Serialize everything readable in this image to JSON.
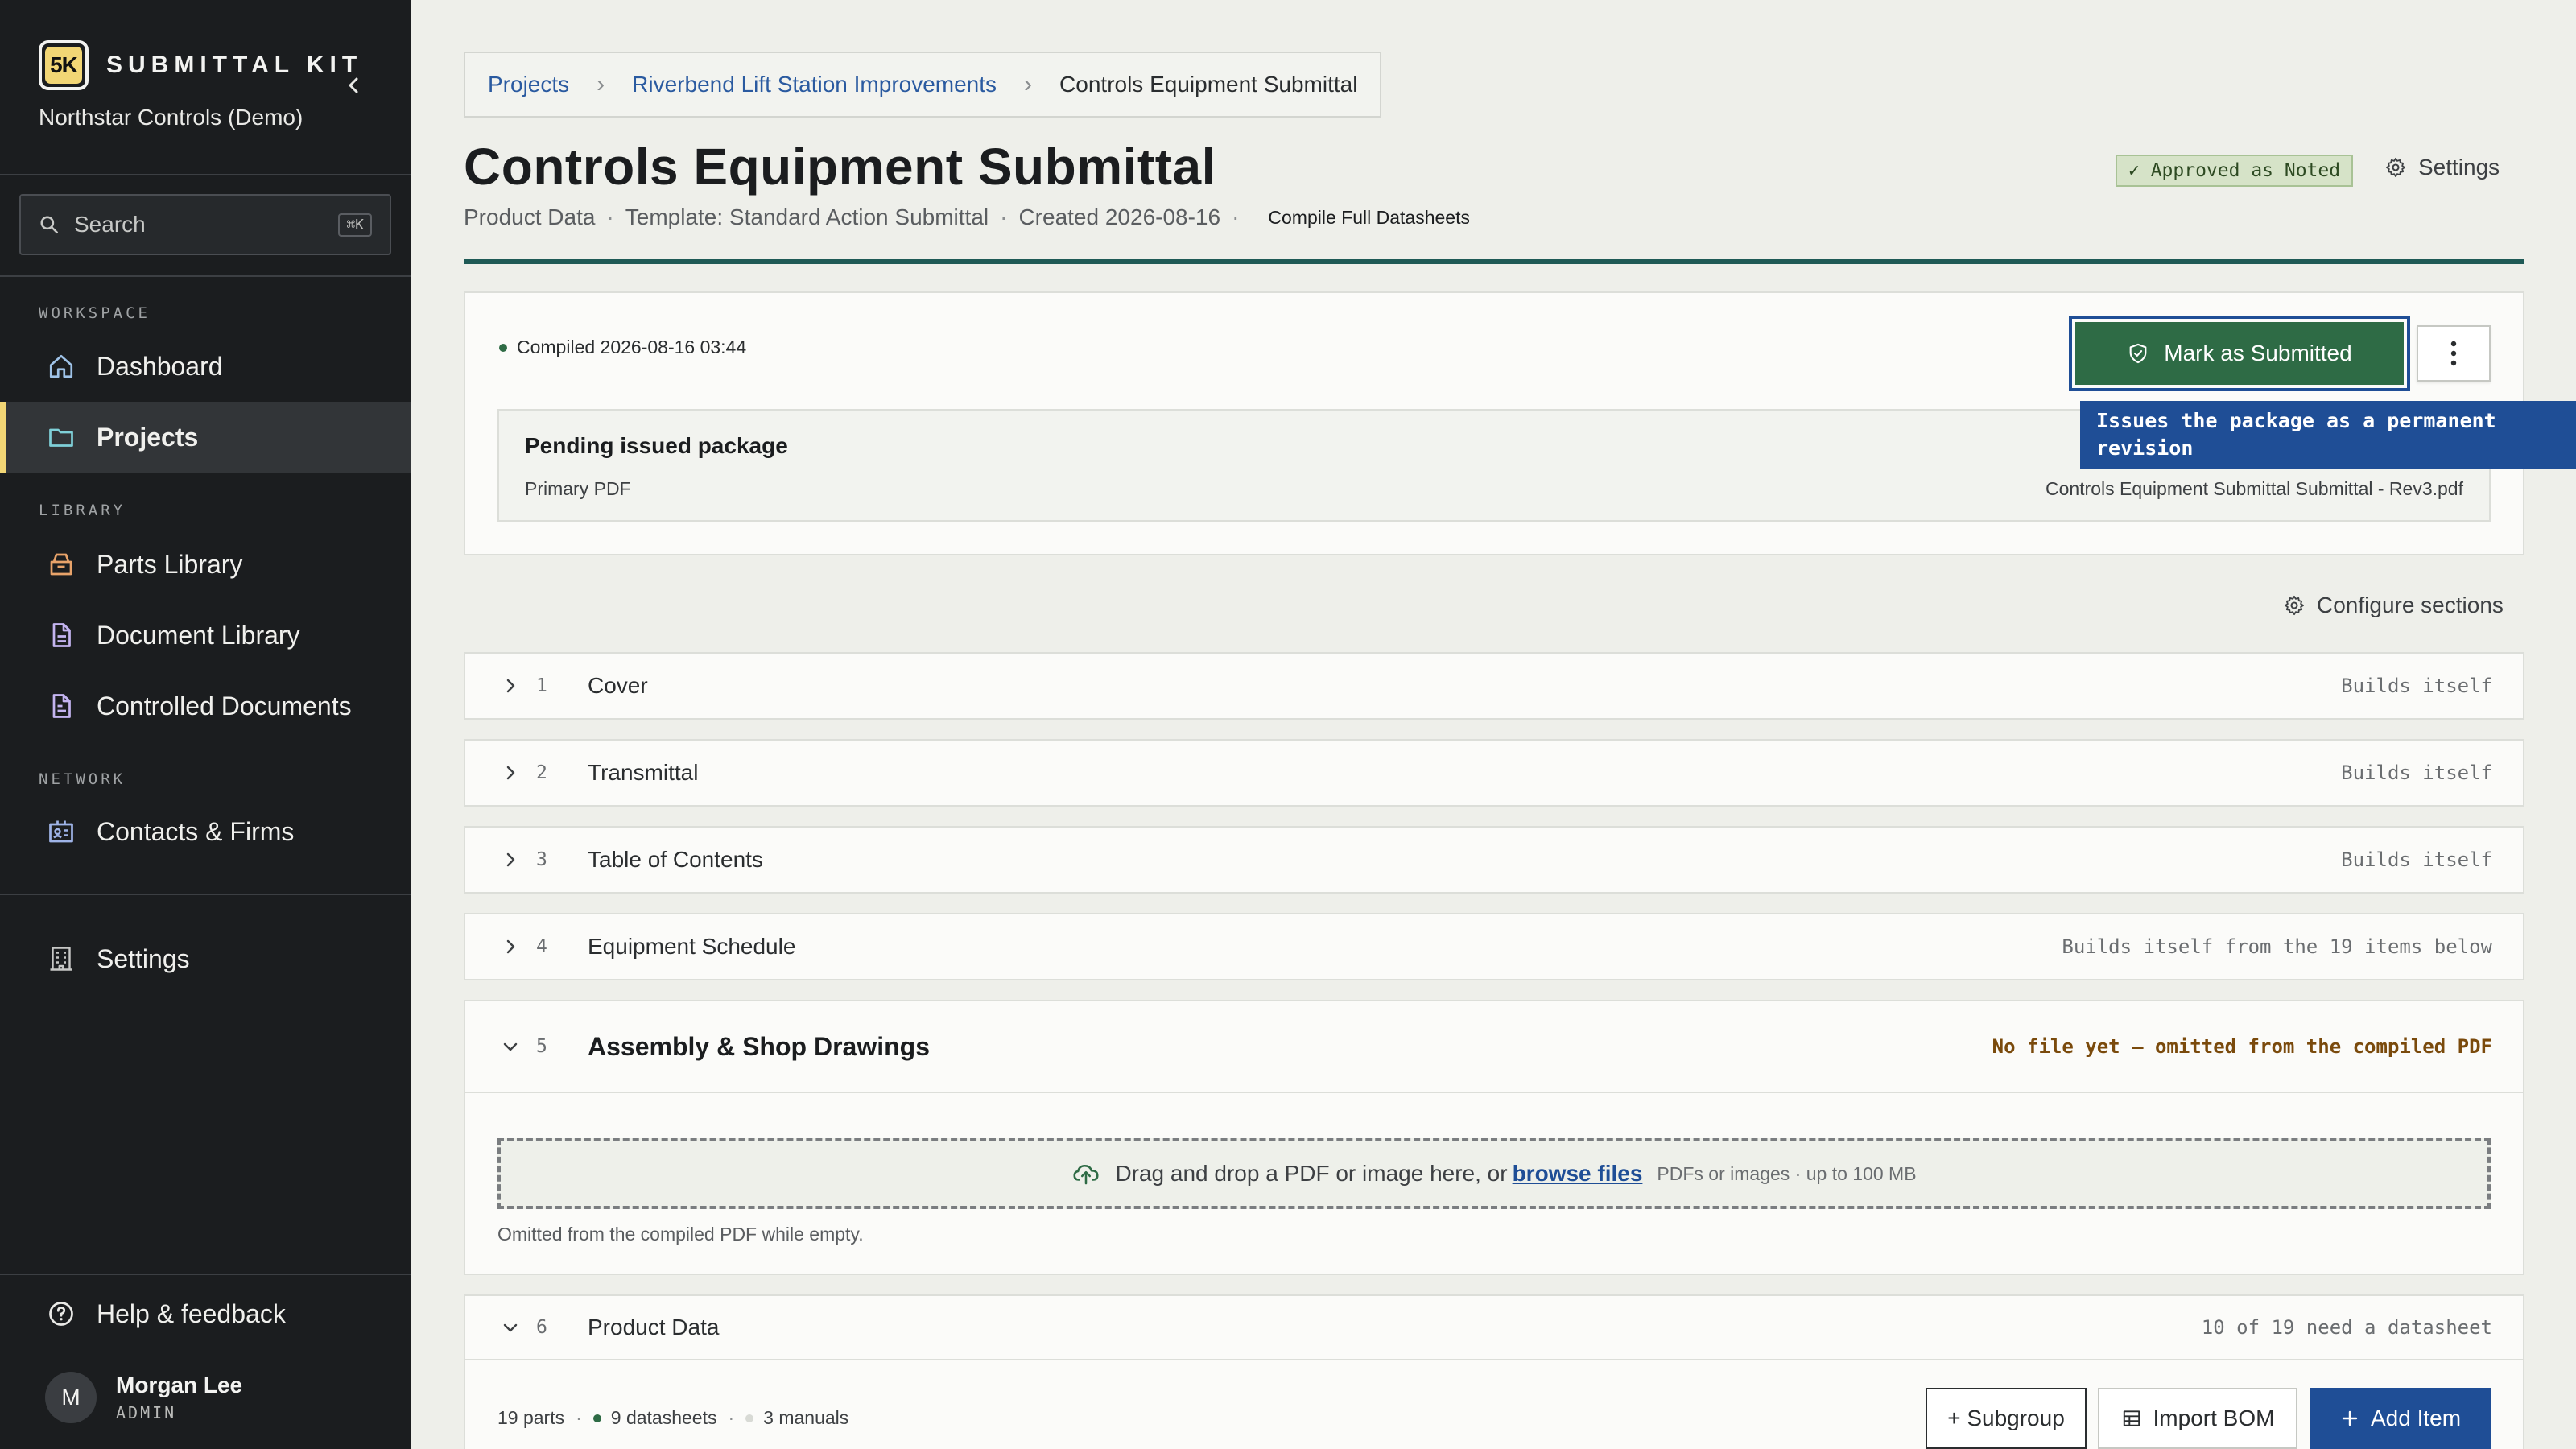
{
  "app": {
    "logo_text": "5K",
    "name": "SUBMITTAL KIT",
    "org": "Northstar Controls (Demo)"
  },
  "search": {
    "placeholder": "Search",
    "shortcut": "⌘K"
  },
  "sidebar": {
    "sections": [
      {
        "label": "WORKSPACE"
      },
      {
        "label": "LIBRARY"
      },
      {
        "label": "NETWORK"
      }
    ],
    "items": [
      {
        "label": "Dashboard",
        "icon": "home-icon"
      },
      {
        "label": "Projects",
        "icon": "folder-icon",
        "active": true
      },
      {
        "label": "Parts Library",
        "icon": "box-icon"
      },
      {
        "label": "Document Library",
        "icon": "document-icon"
      },
      {
        "label": "Controlled Documents",
        "icon": "controlled-document-icon"
      },
      {
        "label": "Contacts & Firms",
        "icon": "contact-card-icon"
      },
      {
        "label": "Settings",
        "icon": "building-icon"
      }
    ],
    "help": "Help & feedback",
    "user": {
      "initial": "M",
      "name": "Morgan Lee",
      "role": "ADMIN"
    }
  },
  "breadcrumb": {
    "items": [
      "Projects",
      "Riverbend Lift Station Improvements",
      "Controls Equipment Submittal"
    ]
  },
  "header": {
    "title": "Controls Equipment Submittal",
    "type": "Product Data",
    "template": "Template: Standard Action Submittal",
    "created": "Created 2026-08-16",
    "compile_link": "Compile Full Datasheets",
    "status": "✓ Approved as Noted",
    "settings": "Settings"
  },
  "compile_panel": {
    "compiled": "Compiled 2026-08-16 03:44",
    "submit_label": "Mark as Submitted",
    "tooltip": "Issues the package as a permanent revision",
    "pending_title": "Pending issued package",
    "pending_label": "Primary PDF",
    "pending_file": "Controls Equipment Submittal Submittal - Rev3.pdf"
  },
  "configure": "Configure sections",
  "sections": [
    {
      "num": "1",
      "name": "Cover",
      "status": "Builds itself"
    },
    {
      "num": "2",
      "name": "Transmittal",
      "status": "Builds itself"
    },
    {
      "num": "3",
      "name": "Table of Contents",
      "status": "Builds itself"
    },
    {
      "num": "4",
      "name": "Equipment Schedule",
      "status": "Builds itself from the 19 items below"
    },
    {
      "num": "5",
      "name": "Assembly & Shop Drawings",
      "status": "No file yet — omitted from the compiled PDF"
    },
    {
      "num": "6",
      "name": "Product Data",
      "status": "10 of 19 need a datasheet"
    }
  ],
  "dropzone": {
    "text": "Drag and drop a PDF or image here, or",
    "browse": "browse files",
    "hint": "PDFs or images · up to 100 MB",
    "omitted": "Omitted from the compiled PDF while empty."
  },
  "product_data": {
    "parts": "19 parts",
    "datasheets": "9 datasheets",
    "manuals": "3 manuals",
    "subgroup": "+ Subgroup",
    "import_bom": "Import BOM",
    "add_item": "Add Item"
  },
  "colors": {
    "sidebar_bg": "#1b1d1f",
    "accent_yellow": "#f2d675",
    "primary_blue": "#1f4e96",
    "submit_green": "#2e6b45",
    "title_rule": "#1f5a56"
  }
}
